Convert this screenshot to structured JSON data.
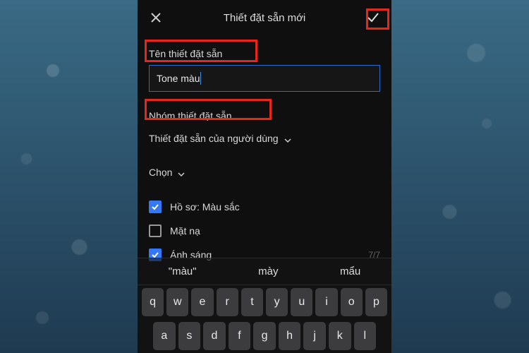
{
  "header": {
    "title": "Thiết đặt sẵn mới"
  },
  "nameSection": {
    "label": "Tên thiết đặt sẵn",
    "value": "Tone màu"
  },
  "groupSection": {
    "label": "Nhóm thiết đặt sẵn",
    "selected": "Thiết đặt sẵn của người dùng"
  },
  "choose": {
    "label": "Chọn"
  },
  "options": [
    {
      "label": "Hồ sơ: Màu sắc",
      "checked": true,
      "count": ""
    },
    {
      "label": "Mặt nạ",
      "checked": false,
      "count": ""
    },
    {
      "label": "Ánh sáng",
      "checked": true,
      "count": "7/7"
    }
  ],
  "suggestions": [
    "\"màu\"",
    "mày",
    "mẩu"
  ],
  "keys": {
    "r1": [
      "q",
      "w",
      "e",
      "r",
      "t",
      "y",
      "u",
      "i",
      "o",
      "p"
    ],
    "r2": [
      "a",
      "s",
      "d",
      "f",
      "g",
      "h",
      "j",
      "k",
      "l"
    ]
  }
}
